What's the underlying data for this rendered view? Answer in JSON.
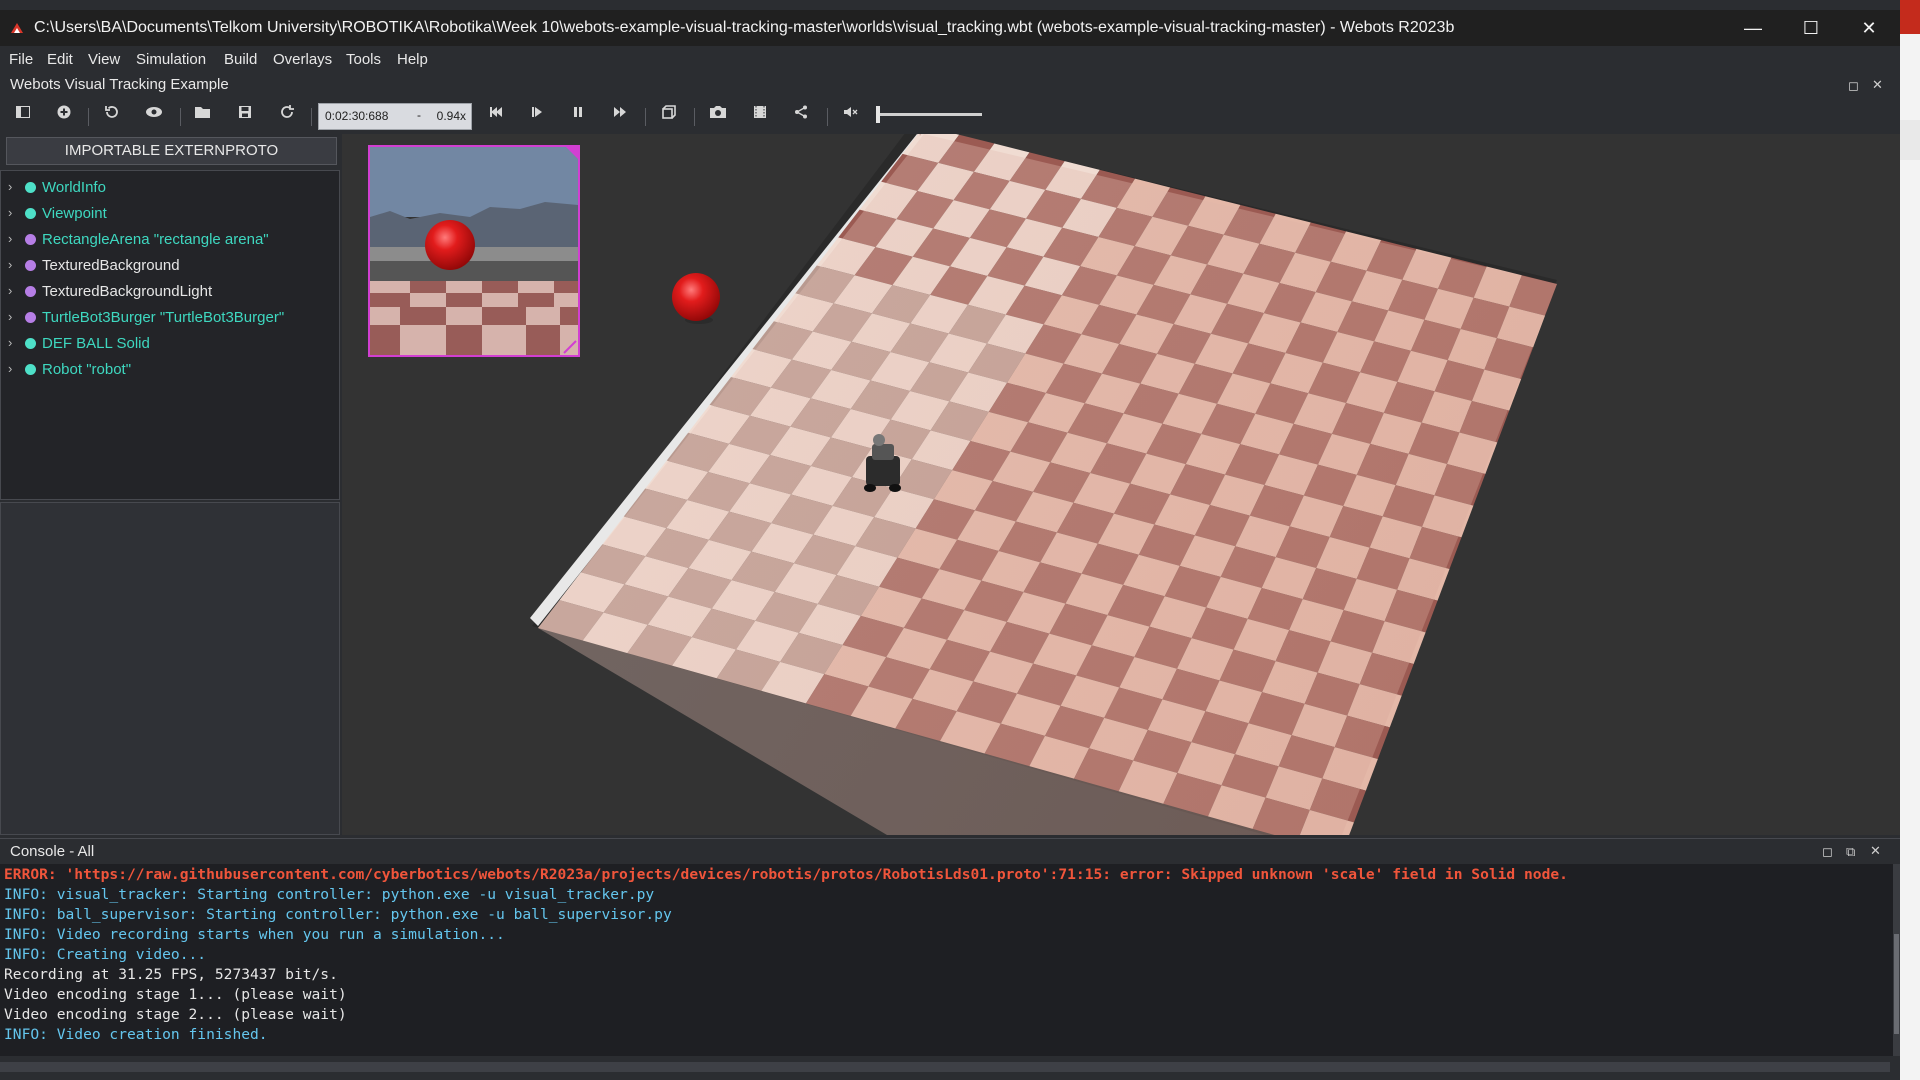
{
  "window": {
    "title": "C:\\Users\\BA\\Documents\\Telkom University\\ROBOTIKA\\Robotika\\Week 10\\webots-example-visual-tracking-master\\worlds\\visual_tracking.wbt (webots-example-visual-tracking-master) - Webots R2023b",
    "controls": {
      "minimize": "—",
      "maximize": "☐",
      "close": "✕"
    }
  },
  "menu": [
    "File",
    "Edit",
    "View",
    "Simulation",
    "Build",
    "Overlays",
    "Tools",
    "Help"
  ],
  "document_title": "Webots Visual Tracking Example",
  "toolbar": {
    "time": "0:02:30:688",
    "dash": "-",
    "speed": "0.94x"
  },
  "scene_tree": {
    "import_button": "IMPORTABLE EXTERNPROTO",
    "nodes": [
      {
        "label": "WorldInfo",
        "color": "#3ed8c0",
        "dot": "#4ee0c8"
      },
      {
        "label": "Viewpoint",
        "color": "#3ed8c0",
        "dot": "#4ee0c8"
      },
      {
        "label": "RectangleArena \"rectangle arena\"",
        "color": "#3ed8c0",
        "dot": "#b67ee6"
      },
      {
        "label": "TexturedBackground",
        "color": "#e6e6e6",
        "dot": "#b67ee6"
      },
      {
        "label": "TexturedBackgroundLight",
        "color": "#e6e6e6",
        "dot": "#b67ee6"
      },
      {
        "label": "TurtleBot3Burger \"TurtleBot3Burger\"",
        "color": "#3ed8c0",
        "dot": "#b67ee6"
      },
      {
        "label": "DEF BALL Solid",
        "color": "#3ed8c0",
        "dot": "#4ee0c8"
      },
      {
        "label": "Robot \"robot\"",
        "color": "#3ed8c0",
        "dot": "#4ee0c8"
      }
    ]
  },
  "console": {
    "title": "Console - All",
    "lines": [
      {
        "type": "err",
        "text": "ERROR: 'https://raw.githubusercontent.com/cyberbotics/webots/R2023a/projects/devices/robotis/protos/RobotisLds01.proto':71:15: error: Skipped unknown 'scale' field in Solid node."
      },
      {
        "type": "info",
        "text": "INFO: visual_tracker: Starting controller: python.exe -u visual_tracker.py"
      },
      {
        "type": "info",
        "text": "INFO: ball_supervisor: Starting controller: python.exe -u ball_supervisor.py"
      },
      {
        "type": "info",
        "text": "INFO: Video recording starts when you run a simulation..."
      },
      {
        "type": "info",
        "text": "INFO: Creating video..."
      },
      {
        "type": "plain",
        "text": "Recording at 31.25 FPS, 5273437 bit/s."
      },
      {
        "type": "plain",
        "text": "Video encoding stage 1... (please wait)"
      },
      {
        "type": "plain",
        "text": "Video encoding stage 2... (please wait)"
      },
      {
        "type": "info",
        "text": "INFO: Video creation finished."
      }
    ]
  },
  "colors": {
    "error": "#f0553b",
    "info": "#64c6ee",
    "ball": "#d01515",
    "camera_border": "#d23fd2"
  },
  "icons": [
    "app-icon",
    "toggle-scene-tree-icon",
    "add-node-icon",
    "reset-viewpoint-icon",
    "view-icon",
    "open-world-icon",
    "save-world-icon",
    "reload-world-icon",
    "step-back-icon",
    "step-icon",
    "pause-icon",
    "fast-forward-icon",
    "render-toggle-icon",
    "screenshot-icon",
    "movie-icon",
    "share-icon",
    "mute-icon"
  ]
}
